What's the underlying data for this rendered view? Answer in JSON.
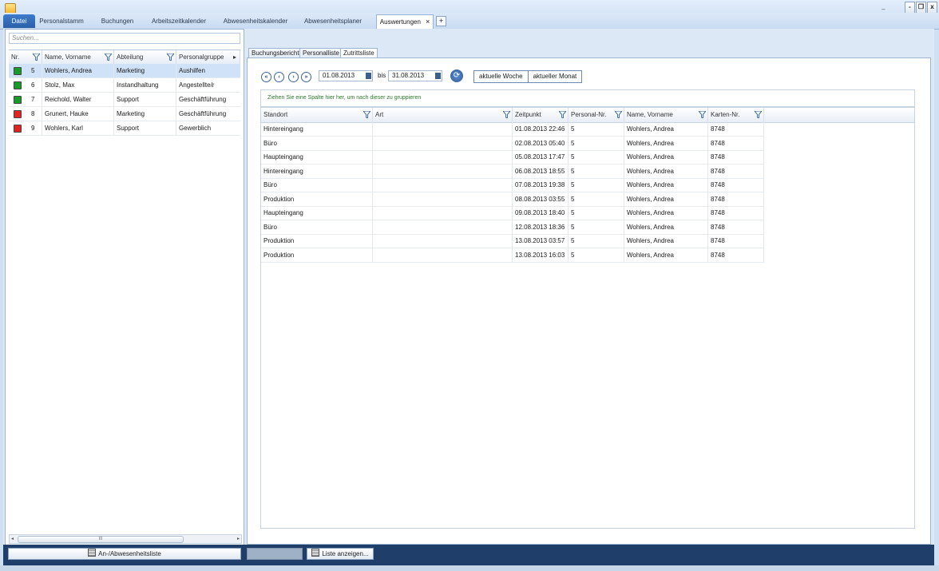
{
  "window": {
    "minimize": "-",
    "restore": "❐",
    "close": "x",
    "small_min": "–"
  },
  "tabs": [
    {
      "label": "Datei"
    },
    {
      "label": "Personalstamm"
    },
    {
      "label": "Buchungen"
    },
    {
      "label": "Arbeitszeitkalender"
    },
    {
      "label": "Abwesenheitskalender"
    },
    {
      "label": "Abwesenheitsplaner"
    },
    {
      "label": "Auswertungen",
      "close": "×"
    }
  ],
  "tab_add": "+",
  "left": {
    "search_placeholder": "Suchen...",
    "columns": [
      "Nr.",
      "Name, Vorname",
      "Abteilung",
      "Personalgruppe"
    ],
    "more": "▸",
    "rows": [
      {
        "status": "#1a9a2a",
        "nr": "5",
        "name": "Wohlers, Andrea",
        "abteilung": "Marketing",
        "gruppe": "Aushilfen"
      },
      {
        "status": "#1a9a2a",
        "nr": "6",
        "name": "Stolz, Max",
        "abteilung": "Instandhaltung",
        "gruppe": "Angestellte/r"
      },
      {
        "status": "#1a9a2a",
        "nr": "7",
        "name": "Reichold, Walter",
        "abteilung": "Support",
        "gruppe": "Geschäftführung"
      },
      {
        "status": "#e02424",
        "nr": "8",
        "name": "Grunert, Hauke",
        "abteilung": "Marketing",
        "gruppe": "Geschäftführung"
      },
      {
        "status": "#e02424",
        "nr": "9",
        "name": "Wohlers, Karl",
        "abteilung": "Support",
        "gruppe": "Gewerblich"
      }
    ],
    "scroll_grip": "III",
    "scroll_left": "◂",
    "scroll_right": "▸"
  },
  "subtabs": [
    "Buchungsbericht",
    "Personalliste",
    "Zutrittsliste"
  ],
  "filter": {
    "nav": [
      "«",
      "‹",
      "›",
      "»"
    ],
    "from": "01.08.2013",
    "bis": "bis",
    "to": "31.08.2013",
    "refresh": "⟳",
    "week": "aktuelle Woche",
    "month": "aktueller Monat"
  },
  "group_hint": "Ziehen Sie eine Spalte hier her, um nach dieser zu gruppieren",
  "table": {
    "columns": [
      "Standort",
      "Art",
      "Zeitpunkt",
      "Personal-Nr.",
      "Name, Vorname",
      "Karten-Nr."
    ],
    "rows": [
      [
        "Hintereingang",
        "",
        "01.08.2013 22:46",
        "5",
        "Wohlers, Andrea",
        "8748"
      ],
      [
        "Büro",
        "",
        "02.08.2013 05:40",
        "5",
        "Wohlers, Andrea",
        "8748"
      ],
      [
        "Haupteingang",
        "",
        "05.08.2013 17:47",
        "5",
        "Wohlers, Andrea",
        "8748"
      ],
      [
        "Hintereingang",
        "",
        "06.08.2013 18:55",
        "5",
        "Wohlers, Andrea",
        "8748"
      ],
      [
        "Büro",
        "",
        "07.08.2013 19:38",
        "5",
        "Wohlers, Andrea",
        "8748"
      ],
      [
        "Produktion",
        "",
        "08.08.2013 03:55",
        "5",
        "Wohlers, Andrea",
        "8748"
      ],
      [
        "Haupteingang",
        "",
        "09.08.2013 18:40",
        "5",
        "Wohlers, Andrea",
        "8748"
      ],
      [
        "Büro",
        "",
        "12.08.2013 18:36",
        "5",
        "Wohlers, Andrea",
        "8748"
      ],
      [
        "Produktion",
        "",
        "13.08.2013 03:57",
        "5",
        "Wohlers, Andrea",
        "8748"
      ],
      [
        "Produktion",
        "",
        "13.08.2013 16:03",
        "5",
        "Wohlers, Andrea",
        "8748"
      ]
    ]
  },
  "bottom": {
    "attendance": "An-/Abwesenheitsliste",
    "blank": "",
    "show_list": "Liste anzeigen..."
  }
}
